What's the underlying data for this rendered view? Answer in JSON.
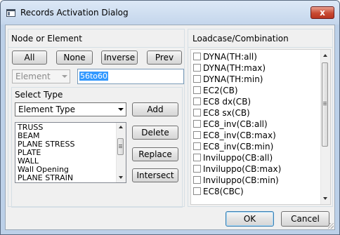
{
  "window": {
    "title": "Records Activation Dialog",
    "close_glyph": "x"
  },
  "node_panel": {
    "header": "Node or Element",
    "buttons": [
      "All",
      "None",
      "Inverse",
      "Prev"
    ],
    "type_combo": "Element",
    "selection_text": "56to60"
  },
  "select_type": {
    "label": "Select Type",
    "combo_value": "Element Type",
    "items": [
      "TRUSS",
      "BEAM",
      "PLANE STRESS",
      "PLATE",
      "WALL",
      "Wall Opening",
      "PLANE STRAIN"
    ],
    "buttons": [
      "Add",
      "Delete",
      "Replace",
      "Intersect"
    ]
  },
  "loadcase_panel": {
    "header": "Loadcase/Combination",
    "items": [
      "DYNA(TH:all)",
      "DYNA(TH:max)",
      "DYNA(TH:min)",
      "EC2(CB)",
      "EC8 dx(CB)",
      "EC8 sx(CB)",
      "EC8_inv(CB:all)",
      "EC8_inv(CB:max)",
      "EC8_inv(CB:min)",
      "Inviluppo(CB:all)",
      "Inviluppo(CB:max)",
      "Inviluppo(CB:min)",
      "EC8(CBC)"
    ]
  },
  "footer": {
    "ok": "OK",
    "cancel": "Cancel"
  }
}
